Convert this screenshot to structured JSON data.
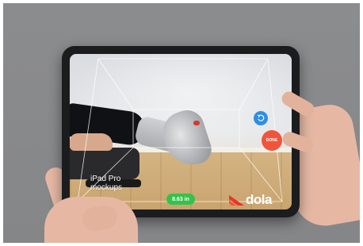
{
  "watermark": {
    "line1": "iPad Pro",
    "line2": "mockups"
  },
  "measurement": {
    "value_label": "8.63 in"
  },
  "buttons": {
    "undo_icon": "undo-icon",
    "done_label": "DONE"
  },
  "brand": {
    "name": "dola",
    "icon": "dola-logo-icon"
  },
  "colors": {
    "done": "#f0553b",
    "undo": "#2f8de4",
    "measure": "#34c24a",
    "logo": "#e8352a"
  }
}
